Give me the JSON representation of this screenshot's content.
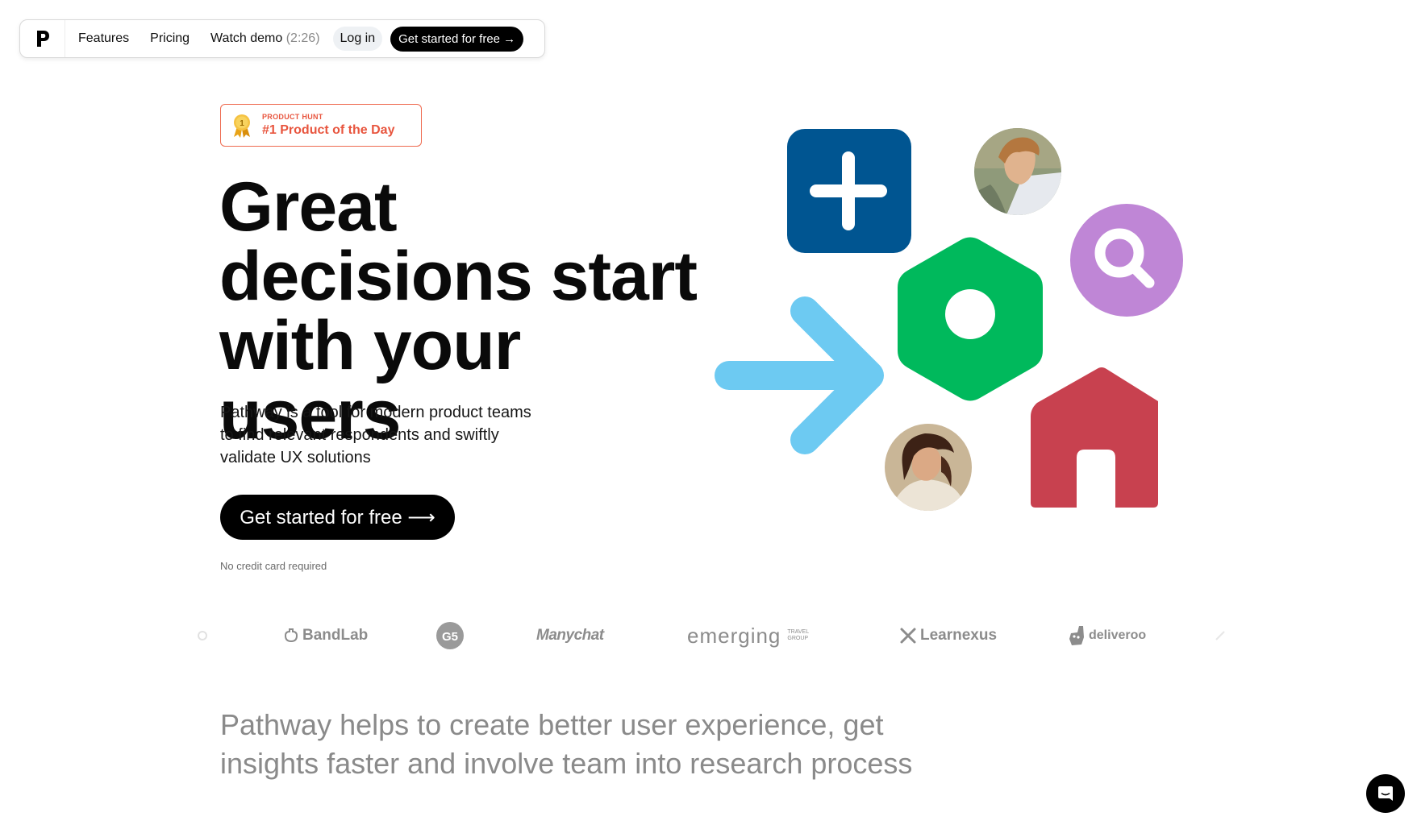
{
  "nav": {
    "logo_letter": "P",
    "features": "Features",
    "pricing": "Pricing",
    "watch_demo": "Watch demo",
    "demo_duration": "(2:26)",
    "login": "Log in",
    "cta": "Get started for free →"
  },
  "badge": {
    "small": "PRODUCT HUNT",
    "big": "#1 Product of the Day",
    "medal_number": "1"
  },
  "hero": {
    "title_line1": "Great",
    "title_line2": "decisions start",
    "title_line3": "with your users",
    "subtitle_line1": "Pathway is a tool for modern product teams",
    "subtitle_line2": "to find relevant respondents and swiftly",
    "subtitle_line3": "validate UX solutions",
    "cta": "Get started for free ⟶",
    "note": "No credit card required"
  },
  "colors": {
    "plus_tile": "#005591",
    "hexagon": "#00b95c",
    "search_circle": "#bf86d6",
    "arrow": "#6dcaf2",
    "house": "#c8414f",
    "badge_accent": "#e8553e"
  },
  "logos": {
    "bandlab": "BandLab",
    "g5": "G5",
    "manychat": "Manychat",
    "emerging": "emerging",
    "emerging_sub1": "TRAVEL",
    "emerging_sub2": "GROUP",
    "learnexus": "Learnexus",
    "deliveroo": "deliveroo"
  },
  "bottom": {
    "line1": "Pathway helps to create better user experience, get",
    "line2": "insights faster and involve team into research process"
  },
  "icons": {
    "chat": "chat-bubble-icon",
    "medal": "medal-icon",
    "plus": "plus-icon",
    "search": "search-icon",
    "arrow": "arrow-right-icon",
    "house": "house-icon"
  }
}
